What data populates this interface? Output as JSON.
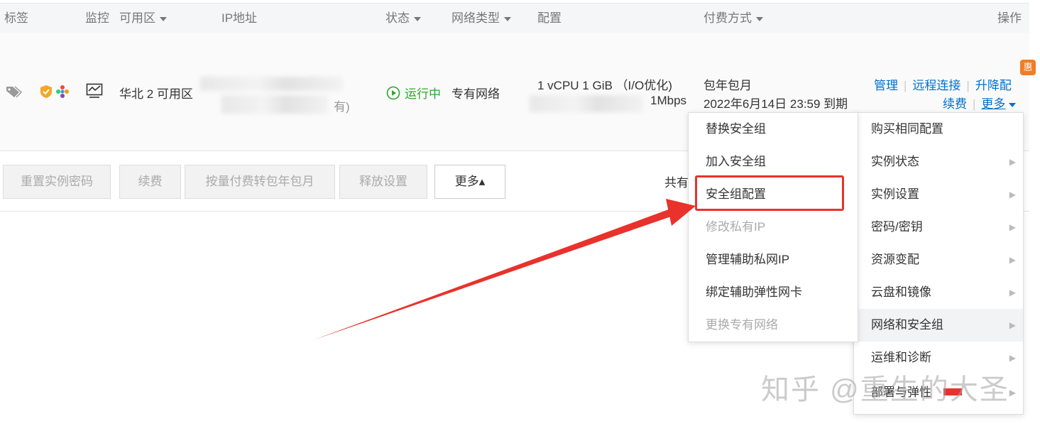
{
  "header": {
    "tag": "标签",
    "monitor": "监控",
    "zone": "可用区",
    "ip": "IP地址",
    "status": "状态",
    "network_type": "网络类型",
    "config": "配置",
    "billing": "付费方式",
    "actions": "操作"
  },
  "instance": {
    "zone": "华北 2 可用区",
    "ip_tail": "有)",
    "status": "运行中",
    "network": "专有网络",
    "config_line1": "1 vCPU 1 GiB （I/O优化)",
    "config_line2": "1Mbps",
    "billing_line1": "包年包月",
    "billing_line2": "2022年6月14日 23:59 到期",
    "promo_badge": "惠",
    "actions": {
      "manage": "管理",
      "remote": "远程连接",
      "upgrade": "升降配",
      "renew": "续费",
      "more": "更多"
    }
  },
  "toolbar": {
    "reset_password": "重置实例密码",
    "renew": "续费",
    "convert": "按量付费转包年包月",
    "release": "释放设置",
    "more": "更多▴",
    "total_prefix": "共有"
  },
  "main_menu": [
    {
      "label": "购买相同配置",
      "submenu": false
    },
    {
      "label": "实例状态",
      "submenu": true
    },
    {
      "label": "实例设置",
      "submenu": true
    },
    {
      "label": "密码/密钥",
      "submenu": true
    },
    {
      "label": "资源变配",
      "submenu": true
    },
    {
      "label": "云盘和镜像",
      "submenu": true
    },
    {
      "label": "网络和安全组",
      "submenu": true,
      "highlighted": true
    },
    {
      "label": "运维和诊断",
      "submenu": true
    },
    {
      "label": "部署与弹性",
      "submenu": true
    }
  ],
  "sub_menu": [
    {
      "label": "替换安全组",
      "disabled": false
    },
    {
      "label": "加入安全组",
      "disabled": false
    },
    {
      "label": "安全组配置",
      "disabled": false,
      "boxed": true
    },
    {
      "label": "修改私有IP",
      "disabled": true
    },
    {
      "label": "管理辅助私网IP",
      "disabled": false
    },
    {
      "label": "绑定辅助弹性网卡",
      "disabled": false
    },
    {
      "label": "更换专有网络",
      "disabled": true
    }
  ],
  "watermark": "知乎 @重生的大圣",
  "colors": {
    "link": "#0070cc",
    "running": "#2fa52f",
    "annotation": "#e8322b",
    "badge": "#f07d26"
  }
}
